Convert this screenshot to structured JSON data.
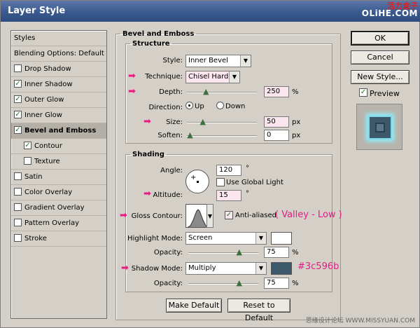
{
  "window": {
    "title": "Layer Style"
  },
  "watermark_top": {
    "line1": "活力盒子",
    "line2": "OLiHE.COM"
  },
  "styles_list": {
    "items": [
      {
        "label": "Styles",
        "checkbox": false,
        "checked": false,
        "selected": false,
        "indent": false
      },
      {
        "label": "Blending Options: Default",
        "checkbox": false,
        "checked": false,
        "selected": false,
        "indent": false
      },
      {
        "label": "Drop Shadow",
        "checkbox": true,
        "checked": false,
        "selected": false,
        "indent": false
      },
      {
        "label": "Inner Shadow",
        "checkbox": true,
        "checked": true,
        "selected": false,
        "indent": false
      },
      {
        "label": "Outer Glow",
        "checkbox": true,
        "checked": true,
        "selected": false,
        "indent": false
      },
      {
        "label": "Inner Glow",
        "checkbox": true,
        "checked": true,
        "selected": false,
        "indent": false
      },
      {
        "label": "Bevel and Emboss",
        "checkbox": true,
        "checked": true,
        "selected": true,
        "indent": false
      },
      {
        "label": "Contour",
        "checkbox": true,
        "checked": true,
        "selected": false,
        "indent": true
      },
      {
        "label": "Texture",
        "checkbox": true,
        "checked": false,
        "selected": false,
        "indent": true
      },
      {
        "label": "Satin",
        "checkbox": true,
        "checked": false,
        "selected": false,
        "indent": false
      },
      {
        "label": "Color Overlay",
        "checkbox": true,
        "checked": false,
        "selected": false,
        "indent": false
      },
      {
        "label": "Gradient Overlay",
        "checkbox": true,
        "checked": false,
        "selected": false,
        "indent": false
      },
      {
        "label": "Pattern Overlay",
        "checkbox": true,
        "checked": false,
        "selected": false,
        "indent": false
      },
      {
        "label": "Stroke",
        "checkbox": true,
        "checked": false,
        "selected": false,
        "indent": false
      }
    ]
  },
  "bevel": {
    "group_title": "Bevel and Emboss",
    "structure": {
      "title": "Structure",
      "style_label": "Style:",
      "style_value": "Inner Bevel",
      "technique_label": "Technique:",
      "technique_value": "Chisel Hard",
      "depth_label": "Depth:",
      "depth_value": "250",
      "depth_unit": "%",
      "depth_slider": 0.25,
      "direction_label": "Direction:",
      "dir_up": "Up",
      "dir_down": "Down",
      "direction_selected": "Up",
      "size_label": "Size:",
      "size_value": "50",
      "size_unit": "px",
      "size_slider": 0.2,
      "soften_label": "Soften:",
      "soften_value": "0",
      "soften_unit": "px",
      "soften_slider": 0.0
    },
    "shading": {
      "title": "Shading",
      "angle_label": "Angle:",
      "angle_value": "120",
      "angle_unit": "°",
      "global_light_label": "Use Global Light",
      "global_light_checked": false,
      "altitude_label": "Altitude:",
      "altitude_value": "15",
      "altitude_unit": "°",
      "gloss_label": "Gloss Contour:",
      "anti_alias_label": "Anti-aliased",
      "anti_alias_checked": true,
      "highlight_label": "Highlight Mode:",
      "highlight_mode": "Screen",
      "highlight_color": "#ffffff",
      "highlight_opacity_label": "Opacity:",
      "highlight_opacity": "75",
      "highlight_opacity_unit": "%",
      "highlight_opacity_slider": 0.75,
      "shadow_label": "Shadow Mode:",
      "shadow_mode": "Multiply",
      "shadow_color": "#3c596b",
      "shadow_opacity_label": "Opacity:",
      "shadow_opacity": "75",
      "shadow_opacity_unit": "%",
      "shadow_opacity_slider": 0.75
    },
    "make_default": "Make Default",
    "reset_default": "Reset to Default"
  },
  "annotations": {
    "gloss_note": "( Valley - Low )",
    "shadow_color_note": "#3c596b",
    "accent": "#e81a84"
  },
  "buttons": {
    "ok": "OK",
    "cancel": "Cancel",
    "new_style": "New Style...",
    "preview_label": "Preview",
    "preview_checked": true
  },
  "watermark_bottom": "思缘设计论坛 WWW.MISSYUAN.COM"
}
